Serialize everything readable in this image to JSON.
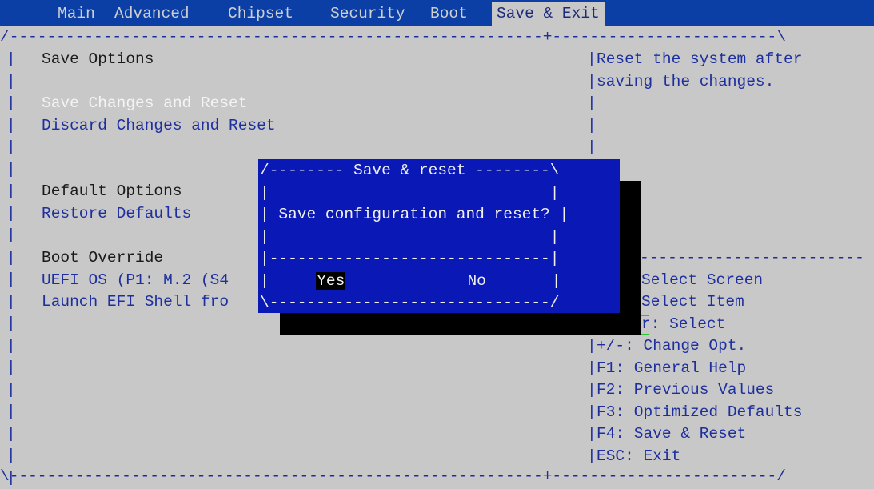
{
  "menu": {
    "tabs": [
      "Main",
      "Advanced",
      "Chipset",
      "Security",
      "Boot",
      "Save & Exit"
    ],
    "active_tab": "Save & Exit"
  },
  "frame": {
    "top_border": "/---------------------------------------------------------+------------------------\\",
    "bottom_border": "\\---------------------------------------------------------+------------------------/"
  },
  "left": {
    "save_options_heading": "Save Options",
    "save_changes_and_reset": "Save Changes and Reset",
    "discard_changes_and_reset": "Discard Changes and Reset",
    "default_options_heading": "Default Options",
    "restore_defaults": "Restore Defaults",
    "boot_override_heading": "Boot Override",
    "uefi_os_item": "UEFI OS (P1: M.2 (S4",
    "launch_efi_shell_item": "Launch EFI Shell fro"
  },
  "right_help": {
    "line1": "Reset the system after",
    "line2": "saving the changes."
  },
  "key_help": {
    "separator": "------------------------",
    "select_screen": "Select Screen",
    "select_item": "Select Item",
    "enter_select": "r: Select",
    "change_opt": "+/-: Change Opt.",
    "f1": "F1: General Help",
    "f2": "F2: Previous Values",
    "f3": "F3: Optimized Defaults",
    "f4": "F4: Save & Reset",
    "esc": "ESC: Exit"
  },
  "dialog": {
    "title_line": "/-------- Save & reset --------\\",
    "message": "Save configuration and reset?",
    "divider": "|------------------------------|",
    "bottom": "\\------------------------------/",
    "yes": "Yes",
    "no": "No"
  }
}
